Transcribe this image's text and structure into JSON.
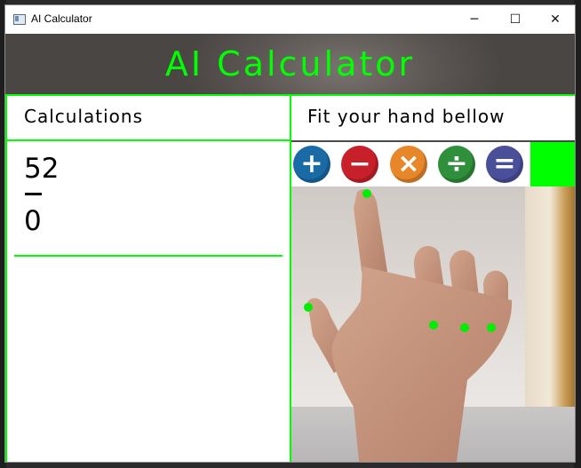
{
  "window": {
    "title": "AI Calculator",
    "controls": {
      "minimize": "─",
      "maximize": "☐",
      "close": "✕"
    }
  },
  "app": {
    "title": "AI Calculator",
    "accent_color": "#00ff00"
  },
  "left_panel": {
    "header": "Calculations",
    "first_number": "52",
    "operator": "−",
    "second_number": "0"
  },
  "right_panel": {
    "header": "Fit your hand bellow",
    "operations": [
      {
        "name": "add",
        "glyph": "+",
        "color": "#1a6aa6"
      },
      {
        "name": "subtract",
        "glyph": "−",
        "color": "#c8202a"
      },
      {
        "name": "multiply",
        "glyph": "×",
        "color": "#e8872a"
      },
      {
        "name": "divide",
        "glyph": "÷",
        "color": "#2f8f3a"
      },
      {
        "name": "equals",
        "glyph": "=",
        "color": "#4a4f9a"
      }
    ]
  }
}
